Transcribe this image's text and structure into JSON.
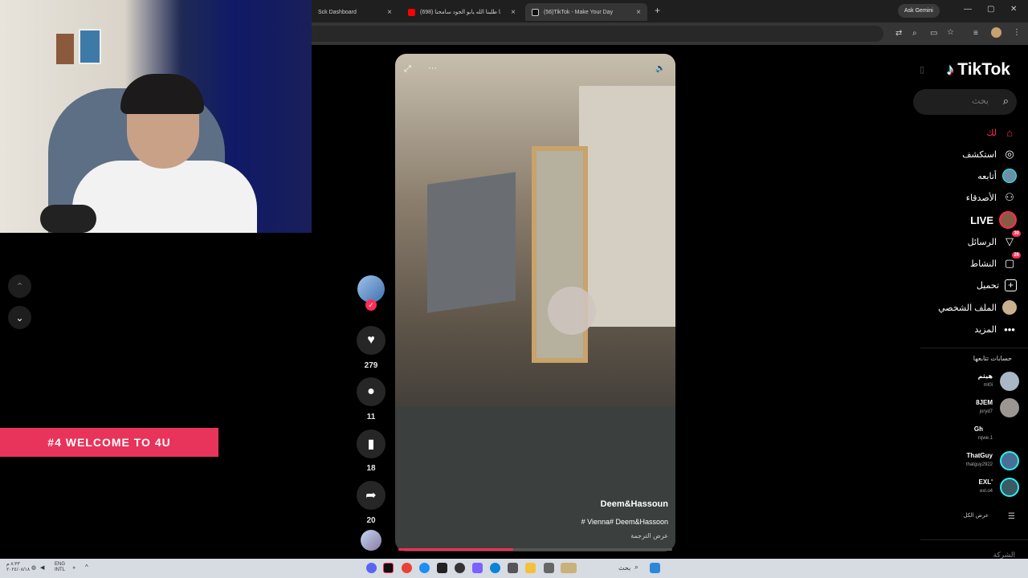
{
  "browser": {
    "tabs": [
      {
        "title": "Sck Dashboard",
        "close": "×"
      },
      {
        "title": "(698) حنا طلبنا الله يابو الجود سامحنا",
        "close": "×"
      },
      {
        "title": "(56)TikTok - Make Your Day",
        "close": "×"
      }
    ],
    "new_tab": "+",
    "gemini_label": "Ask Gemini",
    "window_controls": [
      "—",
      "▢",
      "✕"
    ]
  },
  "overlay": {
    "banner_text": "#4 WELCOME TO 4U"
  },
  "feed_nav": {
    "up_icon": "⌃",
    "down_icon": "⌄"
  },
  "video": {
    "author": "Deem&Hassoun",
    "caption": "# Vienna# Deem&Hassoon",
    "translate": "عرض الترجمة",
    "progress": 0.42,
    "expand_icon": "⤢",
    "more_icon": "···",
    "volume_icon": "🔊"
  },
  "actions": {
    "likes": "279",
    "comments": "11",
    "saves": "18",
    "shares": "20"
  },
  "sidebar": {
    "logo": "TikTok",
    "search_placeholder": "بحث",
    "nav": [
      {
        "label": "لك",
        "icon": "home-icon",
        "active": true
      },
      {
        "label": "استكشف",
        "icon": "compass-icon"
      },
      {
        "label": "أتابعه",
        "icon": "following-icon"
      },
      {
        "label": "الأصدقاء",
        "icon": "friends-icon"
      },
      {
        "label": "LIVE",
        "icon": "live-icon"
      },
      {
        "label": "الرسائل",
        "icon": "messages-icon",
        "badge": "30"
      },
      {
        "label": "النشاط",
        "icon": "activity-icon",
        "badge": "26"
      },
      {
        "label": "تحميل",
        "icon": "upload-icon"
      },
      {
        "label": "الملف الشخصي",
        "icon": "profile-icon"
      },
      {
        "label": "المزيد",
        "icon": "more-icon"
      }
    ],
    "following_title": "حسابات تتابعها",
    "accounts": [
      {
        "name": "هيثم",
        "handle": "mt0i"
      },
      {
        "name": "8JEM",
        "handle": "joryd7"
      },
      {
        "name": "Gh",
        "handle": "rqwe.1"
      },
      {
        "name": "ThatGuy",
        "handle": "thatguy2922"
      },
      {
        "name": "EXL'",
        "handle": "exl.o4"
      }
    ],
    "show_all": "عرض الكل",
    "footer_partial": "الشركة"
  },
  "taskbar": {
    "time": "٨:٣٣ م",
    "date": "٢٠٢٤/٠٨/١٨",
    "lang_top": "ENG",
    "lang_bottom": "INTL",
    "search_label": "بحث"
  },
  "colors": {
    "accent": "#fe2c55",
    "banner": "#e8335a"
  }
}
